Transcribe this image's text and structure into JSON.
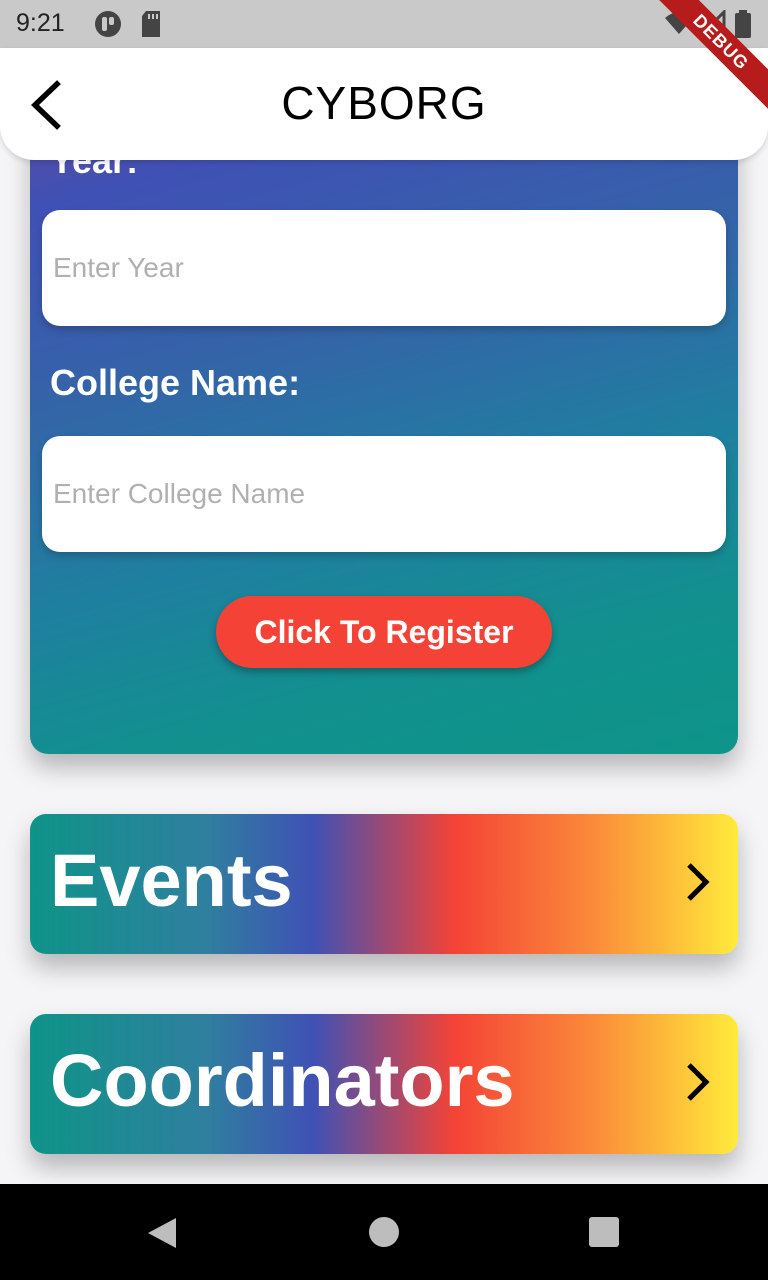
{
  "status_bar": {
    "time": "9:21",
    "icons": [
      "app-notification-icon",
      "sd-card-icon",
      "wifi-icon",
      "signal-icon",
      "battery-icon"
    ]
  },
  "debug_banner": {
    "label": "DEBUG"
  },
  "app_bar": {
    "title": "CYBORG",
    "back_icon": "chevron-left-icon"
  },
  "registration_form": {
    "year_label": "Year:",
    "year_placeholder": "Enter Year",
    "year_value": "",
    "college_label": "College Name:",
    "college_placeholder": "Enter College Name",
    "college_value": "",
    "register_label": "Click To Register"
  },
  "menu": {
    "items": [
      {
        "label": "Events",
        "icon": "chevron-right-icon"
      },
      {
        "label": "Coordinators",
        "icon": "chevron-right-icon"
      }
    ]
  },
  "colors": {
    "accent_red": "#f44336",
    "teal": "#0e9488",
    "indigo": "#3f51b5",
    "yellow": "#ffeb3b"
  }
}
